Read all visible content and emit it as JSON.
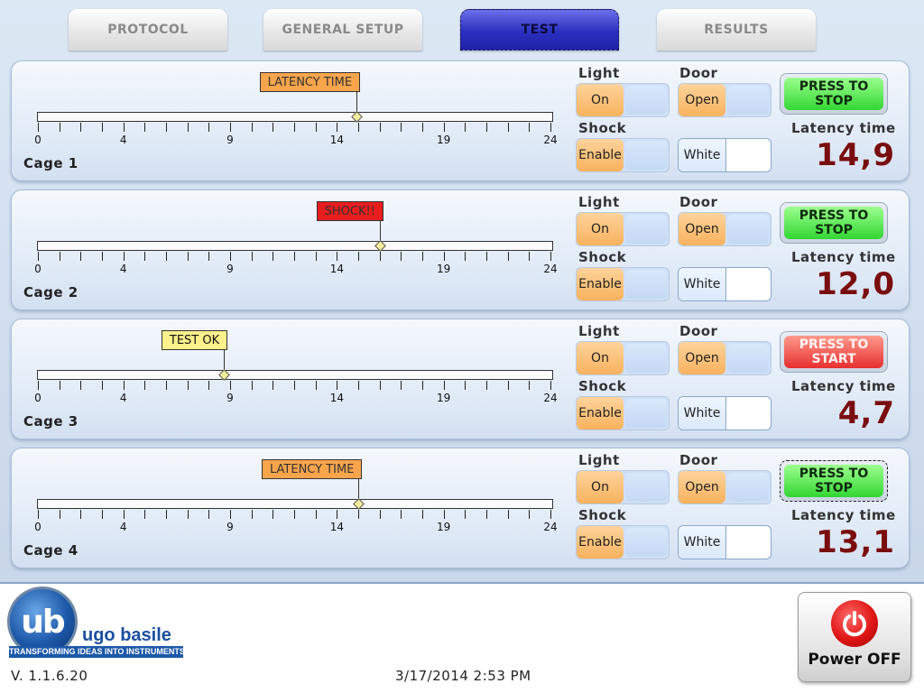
{
  "tabs": [
    {
      "label": "PROTOCOL",
      "active": false
    },
    {
      "label": "GENERAL SETUP",
      "active": false
    },
    {
      "label": "TEST",
      "active": true
    },
    {
      "label": "RESULTS",
      "active": false
    }
  ],
  "scale": {
    "min": 0,
    "max": 24,
    "labels": [
      "0",
      "4",
      "9",
      "14",
      "19",
      "24"
    ]
  },
  "cages": [
    {
      "name": "Cage 1",
      "flag": {
        "text": "LATENCY TIME",
        "style": "latency"
      },
      "marker_value": 14.9,
      "light": {
        "caption": "Light",
        "value": "On"
      },
      "door": {
        "caption": "Door",
        "value": "Open"
      },
      "shock": {
        "caption": "Shock",
        "value": "Enable"
      },
      "white": {
        "value": "White"
      },
      "button": {
        "line1": "PRESS TO",
        "line2": "STOP",
        "kind": "stop"
      },
      "latency_caption": "Latency time",
      "latency_value": "14,9"
    },
    {
      "name": "Cage 2",
      "flag": {
        "text": "SHOCK!!",
        "style": "shock"
      },
      "marker_value": 16,
      "light": {
        "caption": "Light",
        "value": "On"
      },
      "door": {
        "caption": "Door",
        "value": "Open"
      },
      "shock": {
        "caption": "Shock",
        "value": "Enable"
      },
      "white": {
        "value": "White"
      },
      "button": {
        "line1": "PRESS TO",
        "line2": "STOP",
        "kind": "stop"
      },
      "latency_caption": "Latency time",
      "latency_value": "12,0"
    },
    {
      "name": "Cage 3",
      "flag": {
        "text": "TEST OK",
        "style": "ok"
      },
      "marker_value": 8.7,
      "light": {
        "caption": "Light",
        "value": "On"
      },
      "door": {
        "caption": "Door",
        "value": "Open"
      },
      "shock": {
        "caption": "Shock",
        "value": "Enable"
      },
      "white": {
        "value": "White"
      },
      "button": {
        "line1": "PRESS TO",
        "line2": "START",
        "kind": "start"
      },
      "latency_caption": "Latency time",
      "latency_value": "4,7"
    },
    {
      "name": "Cage 4",
      "flag": {
        "text": "LATENCY TIME",
        "style": "latency"
      },
      "marker_value": 15,
      "light": {
        "caption": "Light",
        "value": "On"
      },
      "door": {
        "caption": "Door",
        "value": "Open"
      },
      "shock": {
        "caption": "Shock",
        "value": "Enable"
      },
      "white": {
        "value": "White"
      },
      "button": {
        "line1": "PRESS TO",
        "line2": "STOP",
        "kind": "stop"
      },
      "latency_caption": "Latency time",
      "latency_value": "13,1"
    }
  ],
  "brand": {
    "logo_text": "ub",
    "name": "ugo basile",
    "tagline": "TRANSFORMING IDEAS INTO INSTRUMENTS"
  },
  "version": "V. 1.1.6.20",
  "datetime": "3/17/2014 2:53 PM",
  "power_button": {
    "label": "Power OFF",
    "icon": "power-icon"
  },
  "colors": {
    "flag_latency": "#f8a54c",
    "flag_shock": "#e81e1e",
    "flag_ok": "#fbf08a",
    "button_stop": "#33d633",
    "button_start": "#e72f2f",
    "latency_value": "#7a0d0d",
    "active_tab": "#2a2fc0"
  }
}
